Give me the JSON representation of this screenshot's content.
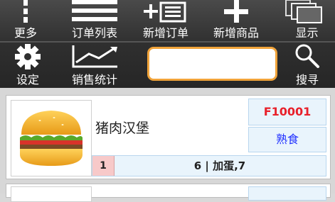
{
  "toolbar": {
    "row1": [
      {
        "id": "more",
        "label": "更多",
        "icon": "more-icon"
      },
      {
        "id": "order-list",
        "label": "订单列表",
        "icon": "list-icon"
      },
      {
        "id": "new-order",
        "label": "新增订单",
        "icon": "add-list-icon"
      },
      {
        "id": "new-product",
        "label": "新增商品",
        "icon": "plus-icon"
      },
      {
        "id": "display",
        "label": "显示",
        "icon": "windows-icon"
      }
    ],
    "row2": [
      {
        "id": "settings",
        "label": "设定",
        "icon": "gear-icon"
      },
      {
        "id": "sales-stats",
        "label": "销售统计",
        "icon": "chart-icon"
      },
      {
        "id": "search",
        "label": "搜寻",
        "icon": "search-icon"
      }
    ],
    "search_value": ""
  },
  "items": [
    {
      "name": "猪肉汉堡",
      "code": "F10001",
      "category": "熟食",
      "index": "1",
      "detail": "6 | 加蛋,7",
      "image": "burger-image"
    }
  ],
  "colors": {
    "toolbar_bg": "#2f2f2f",
    "search_border": "#f0a33a",
    "code_text": "#e8202a",
    "category_text": "#2030ff",
    "index_bg": "#f7c9c9",
    "panel_bg": "#e9f4fc"
  }
}
